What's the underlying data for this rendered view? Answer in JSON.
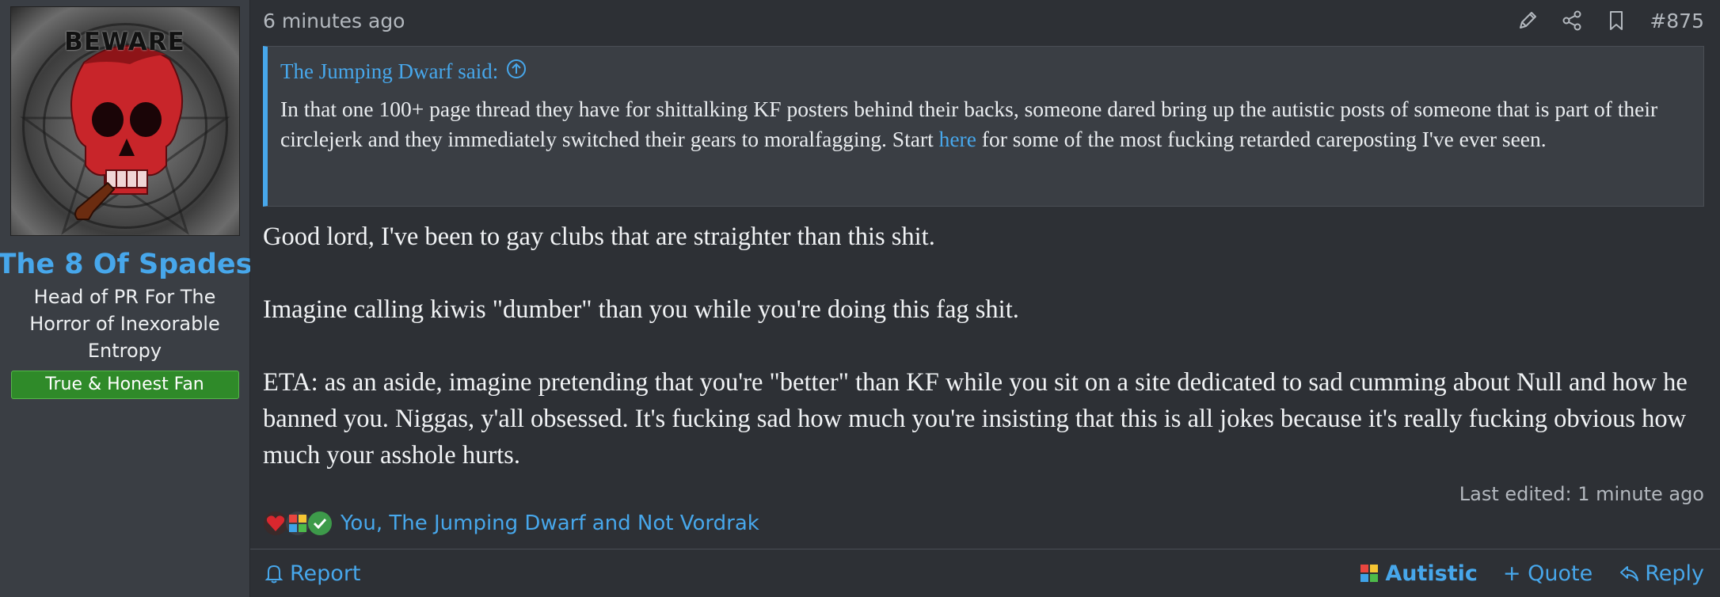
{
  "user": {
    "avatar_text": "BEWARE",
    "name": "The 8 Of Spades",
    "title": "Head of PR For The Horror of Inexorable Entropy",
    "banner": "True & Honest Fan"
  },
  "post": {
    "time": "6 minutes ago",
    "number": "#875",
    "header_icons": [
      "edit-icon",
      "share-icon",
      "bookmark-icon"
    ]
  },
  "quote": {
    "author": "The Jumping Dwarf said:",
    "text_before_link": "In that one 100+ page thread they have for shittalking KF posters behind their backs, someone dared bring up the autistic posts of someone that is part of their circlejerk and they immediately switched their gears to moralfagging. Start ",
    "link_text": "here",
    "text_after_link": " for some of the most fucking retarded careposting I've ever seen."
  },
  "message": {
    "paragraphs": [
      "Good lord, I've been to gay clubs that are straighter than this shit.",
      "Imagine calling kiwis \"dumber\" than you while you're doing this fag shit.",
      "ETA: as an aside, imagine pretending that you're \"better\" than KF while you sit on a site dedicated to sad cumming about Null and how he banned you. Niggas, y'all obsessed. It's fucking sad how much you're insisting that this is all jokes because it's really fucking obvious how much your asshole hurts."
    ],
    "last_edited": "Last edited: 1 minute ago"
  },
  "reactions": {
    "icons": [
      "heart-icon",
      "puzzle-icon",
      "check-icon"
    ],
    "users": "You, The Jumping Dwarf and Not Vordrak"
  },
  "footer": {
    "report": "Report",
    "autistic": "Autistic",
    "quote": "+ Quote",
    "reply": "Reply"
  },
  "colors": {
    "accent": "#47a7eb",
    "background": "#2d3035",
    "panel": "#3a3e44",
    "banner": "#2f8a29"
  }
}
